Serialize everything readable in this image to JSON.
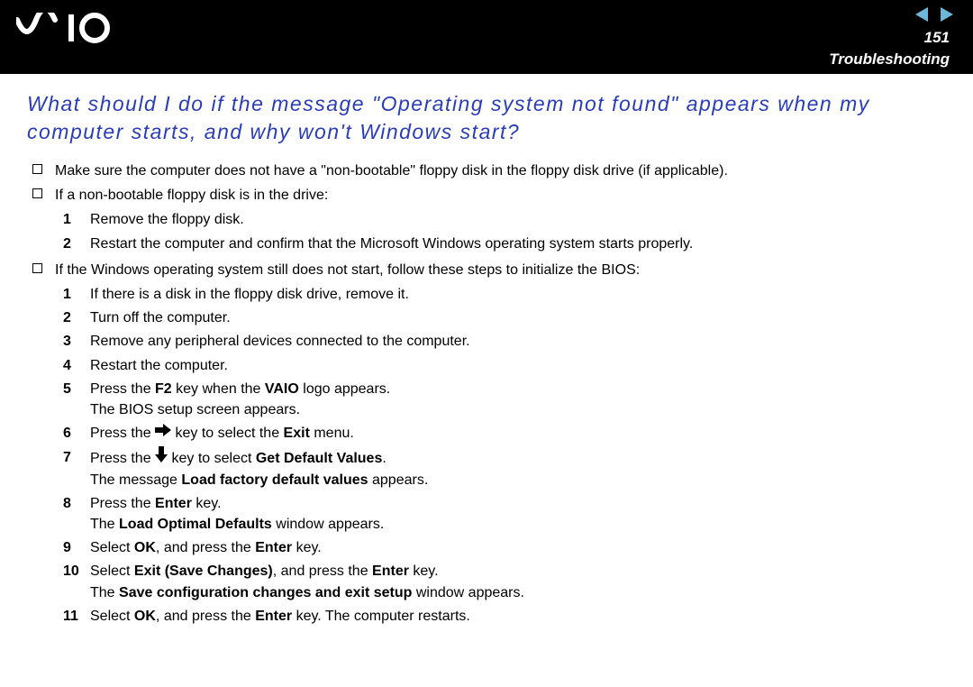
{
  "header": {
    "logo_text": "VAIO",
    "page_number": "151",
    "section": "Troubleshooting"
  },
  "heading": "What should I do if the message \"Operating system not found\" appears when my computer starts, and why won't Windows start?",
  "bullets": {
    "b1": "Make sure the computer does not have a \"non-bootable\" floppy disk in the floppy disk drive (if applicable).",
    "b2": "If a non-bootable floppy disk is in the drive:",
    "b3": "If the Windows operating system still does not start, follow these steps to initialize the BIOS:"
  },
  "listA": {
    "n1": "Remove the floppy disk.",
    "n2": "Restart the computer and confirm that the Microsoft Windows operating system starts properly."
  },
  "listB": {
    "n1": "If there is a disk in the floppy disk drive, remove it.",
    "n2": "Turn off the computer.",
    "n3": "Remove any peripheral devices connected to the computer.",
    "n4": "Restart the computer.",
    "n5_pre": "Press the ",
    "n5_key": "F2",
    "n5_mid": " key when the ",
    "n5_logo": "VAIO",
    "n5_post": " logo appears.",
    "n5_sub": "The BIOS setup screen appears.",
    "n6_pre": "Press the ",
    "n6_mid": " key to select the ",
    "n6_bold": "Exit",
    "n6_post": " menu.",
    "n7_pre": "Press the ",
    "n7_mid": " key to select ",
    "n7_bold": "Get Default Values",
    "n7_post": ".",
    "n7_sub_pre": "The message ",
    "n7_sub_bold": "Load factory default values",
    "n7_sub_post": " appears.",
    "n8_pre": "Press the ",
    "n8_bold": "Enter",
    "n8_post": " key.",
    "n8_sub_pre": "The ",
    "n8_sub_bold": "Load Optimal Defaults",
    "n8_sub_post": " window appears.",
    "n9_pre": "Select ",
    "n9_b1": "OK",
    "n9_mid": ", and press the ",
    "n9_b2": "Enter",
    "n9_post": " key.",
    "n10_pre": "Select ",
    "n10_b1": "Exit (Save Changes)",
    "n10_mid": ", and press the ",
    "n10_b2": "Enter",
    "n10_post": " key.",
    "n10_sub_pre": "The ",
    "n10_sub_bold": "Save configuration changes and exit setup",
    "n10_sub_post": " window appears.",
    "n11_pre": "Select ",
    "n11_b1": "OK",
    "n11_mid": ", and press the ",
    "n11_b2": "Enter",
    "n11_post": " key. The computer restarts."
  },
  "numbers": {
    "l1": "1",
    "l2": "2",
    "l3": "3",
    "l4": "4",
    "l5": "5",
    "l6": "6",
    "l7": "7",
    "l8": "8",
    "l9": "9",
    "l10": "10",
    "l11": "11"
  }
}
